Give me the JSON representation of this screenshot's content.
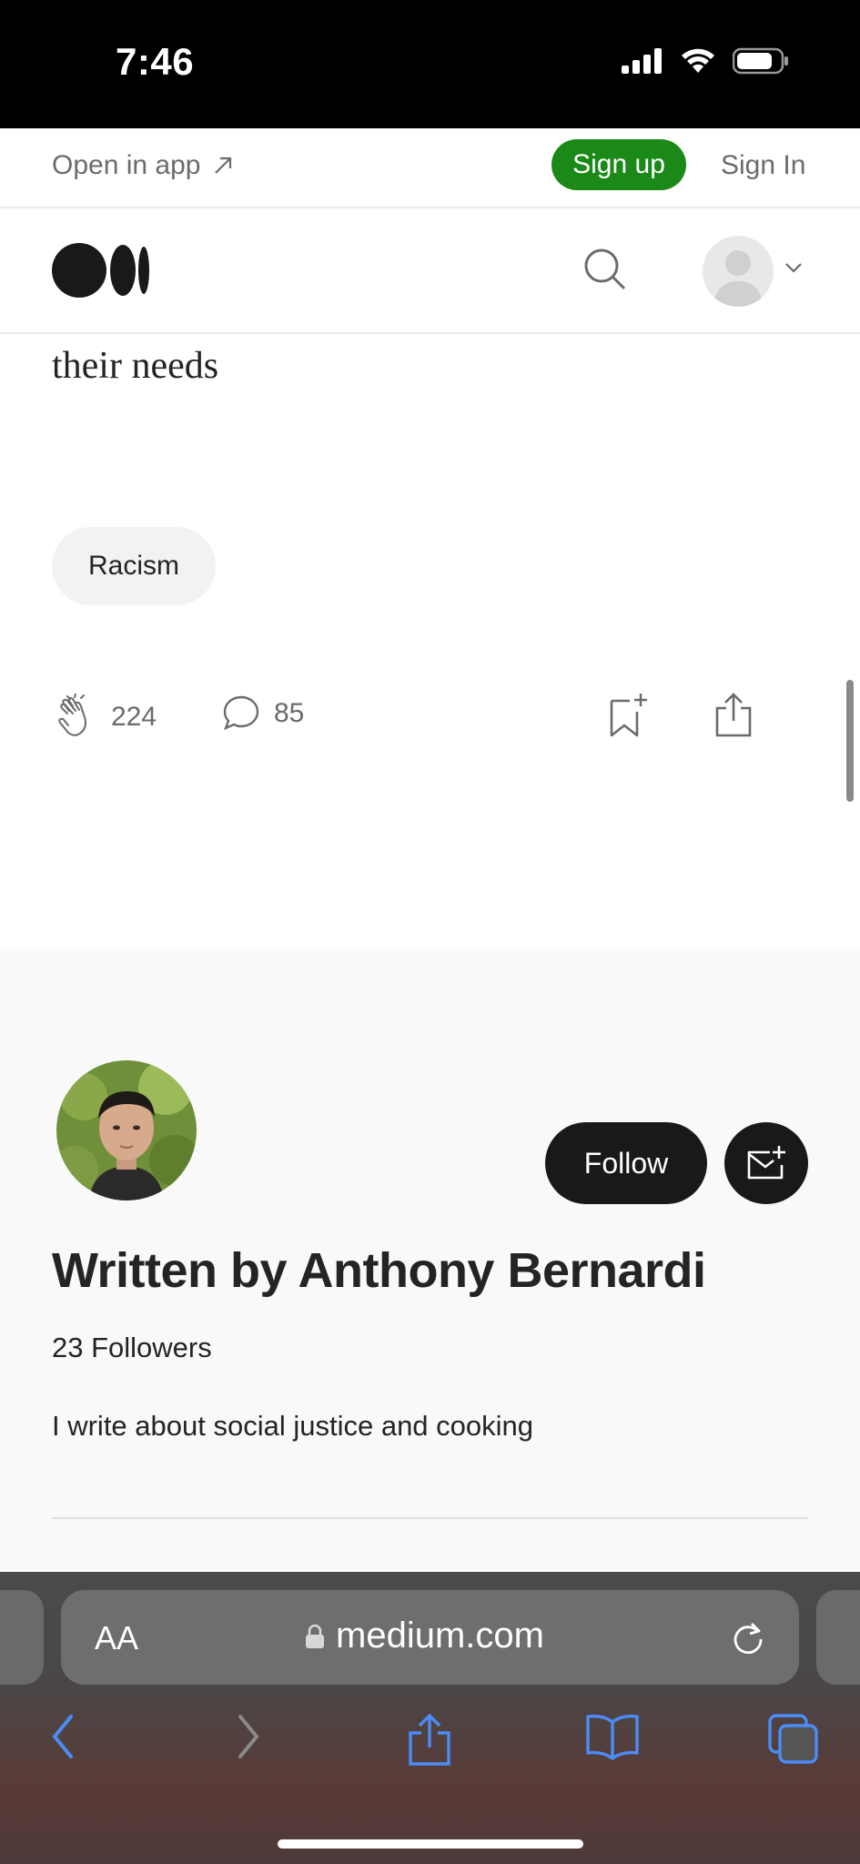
{
  "status_bar": {
    "time": "7:46"
  },
  "app_bar": {
    "open_in_app": "Open in app",
    "sign_up": "Sign up",
    "sign_in": "Sign In"
  },
  "header": {
    "logo": "medium-logo",
    "search": "search-icon",
    "account": "avatar"
  },
  "article": {
    "last_line": "their needs",
    "tag": "Racism",
    "claps": "224",
    "responses": "85"
  },
  "author": {
    "written_by": "Written by Anthony Bernardi",
    "followers": "23 Followers",
    "bio": "I write about social justice and cooking",
    "follow_label": "Follow"
  },
  "browser": {
    "text_size": "AA",
    "url": "medium.com"
  },
  "colors": {
    "accent_green": "#1a8917",
    "dark_button": "#191919",
    "muted_text": "#6b6b6b",
    "safari_blue": "#4b8cf7"
  }
}
